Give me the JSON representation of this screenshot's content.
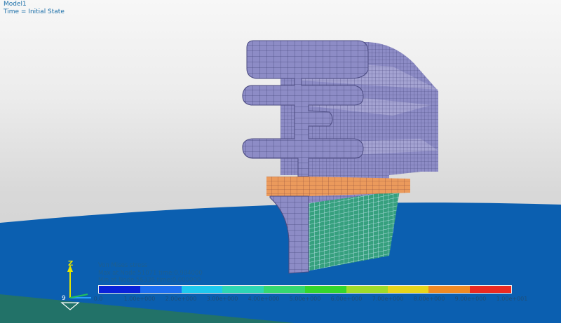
{
  "header": {
    "model_name": "Model1",
    "time_label": "Time = Initial State"
  },
  "legend": {
    "title": "Von Mises stress",
    "max_line": "Max at Node 51071 time:0.984000",
    "min_line": "Min at Node 56336 time:0.000000",
    "ticks": [
      "0.0",
      "1.00e+000",
      "2.00e+000",
      "3.00e+000",
      "4.00e+000",
      "5.00e+000",
      "6.00e+000",
      "7.00e+000",
      "8.00e+000",
      "9.00e+000",
      "1.00e+001"
    ],
    "colors": [
      "#0a22d8",
      "#1e6ff0",
      "#1ec8ee",
      "#2ed6b4",
      "#36d870",
      "#35d62c",
      "#9fdc2a",
      "#e6d51c",
      "#ef8a24",
      "#ea2a22"
    ]
  },
  "triad": {
    "z_label": "Z"
  },
  "scene": {
    "background_top": "#f7f7f7",
    "ground_color": "#0b5fb0",
    "part_color": "#8d8cc6",
    "mesh_line_color": "#4a4a80",
    "top_face_color": "#a4a3d2",
    "contact_color": "#eb9a5c",
    "green_face_color": "#36a07e"
  }
}
